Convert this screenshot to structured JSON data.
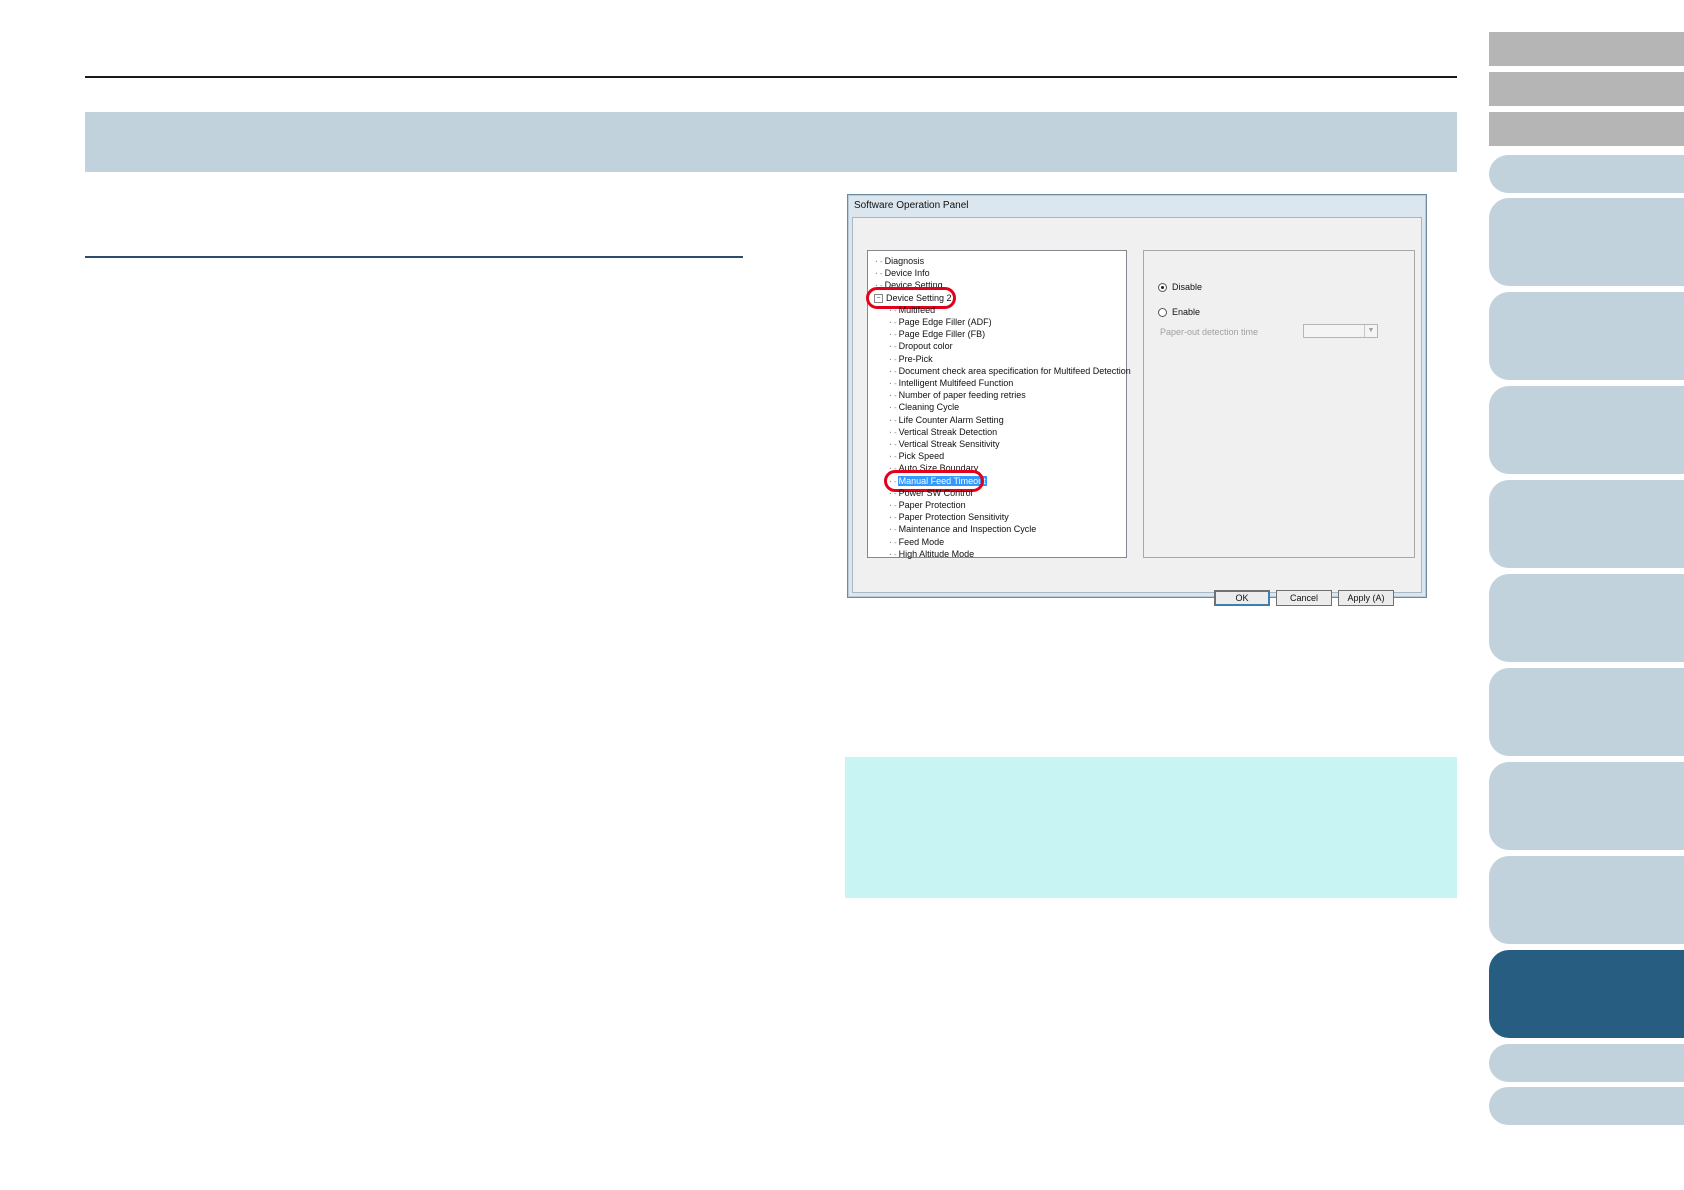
{
  "dialog": {
    "title": "Software Operation Panel",
    "tree": [
      {
        "label": "Diagnosis",
        "level": 0
      },
      {
        "label": "Device Info",
        "level": 0
      },
      {
        "label": "Device Setting",
        "level": 0
      },
      {
        "label": "Device Setting 2",
        "level": 0,
        "expanded": true
      },
      {
        "label": "Multifeed",
        "level": 1
      },
      {
        "label": "Page Edge Filler (ADF)",
        "level": 1
      },
      {
        "label": "Page Edge Filler (FB)",
        "level": 1
      },
      {
        "label": "Dropout color",
        "level": 1
      },
      {
        "label": "Pre-Pick",
        "level": 1
      },
      {
        "label": "Document check area specification for Multifeed Detection",
        "level": 1
      },
      {
        "label": "Intelligent Multifeed Function",
        "level": 1
      },
      {
        "label": "Number of paper feeding retries",
        "level": 1
      },
      {
        "label": "Cleaning Cycle",
        "level": 1
      },
      {
        "label": "Life Counter Alarm Setting",
        "level": 1
      },
      {
        "label": "Vertical Streak Detection",
        "level": 1
      },
      {
        "label": "Vertical Streak Sensitivity",
        "level": 1
      },
      {
        "label": "Pick Speed",
        "level": 1
      },
      {
        "label": "Auto Size Boundary",
        "level": 1
      },
      {
        "label": "Manual Feed Timeout",
        "level": 1,
        "selected": true
      },
      {
        "label": "Power SW Control",
        "level": 1
      },
      {
        "label": "Paper Protection",
        "level": 1
      },
      {
        "label": "Paper Protection Sensitivity",
        "level": 1
      },
      {
        "label": "Maintenance and Inspection Cycle",
        "level": 1
      },
      {
        "label": "Feed Mode",
        "level": 1
      },
      {
        "label": "High Altitude Mode",
        "level": 1
      }
    ],
    "options": {
      "disable_label": "Disable",
      "enable_label": "Enable",
      "selected": "Disable",
      "paper_out_label": "Paper-out detection time",
      "paper_out_value": ""
    },
    "buttons": {
      "ok": "OK",
      "cancel": "Cancel",
      "apply": "Apply (A)"
    }
  },
  "colors": {
    "title_band": "#c2d2dc",
    "note_box": "#c8f4f3",
    "tab_active": "#275d80",
    "tab_inactive": "#c2d2dc",
    "tab_top": "#b5b5b5",
    "highlight_ring": "#e3001b",
    "selection": "#3399ff"
  }
}
